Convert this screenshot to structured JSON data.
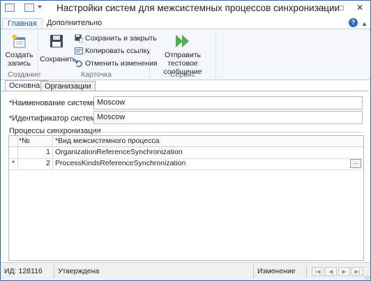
{
  "window": {
    "title": "Настройки систем для межсистемных процессов синхронизации",
    "minimize": "—",
    "maximize": "□",
    "close": "✕"
  },
  "ribbon_tabs": [
    "Главная",
    "Дополнительно"
  ],
  "ribbon": {
    "groups": [
      {
        "label": "Создание"
      },
      {
        "label": "Карточка"
      },
      {
        "label": "Сервис"
      }
    ],
    "create_record": {
      "line1": "Создать",
      "line2": "запись"
    },
    "save": "Сохранить",
    "save_and_close": "Сохранить и закрыть",
    "copy_link": "Копировать ссылку",
    "undo_changes": "Отменить изменения",
    "send_test": {
      "line1": "Отправить тестовое",
      "line2": "сообщение"
    },
    "help": "?",
    "collapse": "▲"
  },
  "form_tabs": [
    "Основная",
    "Организации"
  ],
  "form": {
    "system_name_label": "*Наименование системы:",
    "system_name_value": "Moscow",
    "system_id_label": "*Идентификатор системы:",
    "system_id_value": "Moscow",
    "section_title": "Процессы синхронизации"
  },
  "grid": {
    "headers": [
      "*№",
      "*Вид межсистемного процесса"
    ],
    "rows": [
      {
        "marker": "",
        "num": "1",
        "process": "OrganizationReferenceSynchronization"
      },
      {
        "marker": "*",
        "num": "2",
        "process": "ProcessKindsReferenceSynchronization"
      }
    ],
    "ellipsis": "..."
  },
  "status": {
    "id": "ИД: 128116",
    "state": "Утверждена",
    "mode": "Изменение",
    "nav": [
      "|◀",
      "◀",
      "▶",
      "▶|"
    ]
  },
  "colors": {
    "accent": "#1c5ea8",
    "ribbon_bg": "#f4f7fb",
    "send_arrow": "#4caf50"
  }
}
